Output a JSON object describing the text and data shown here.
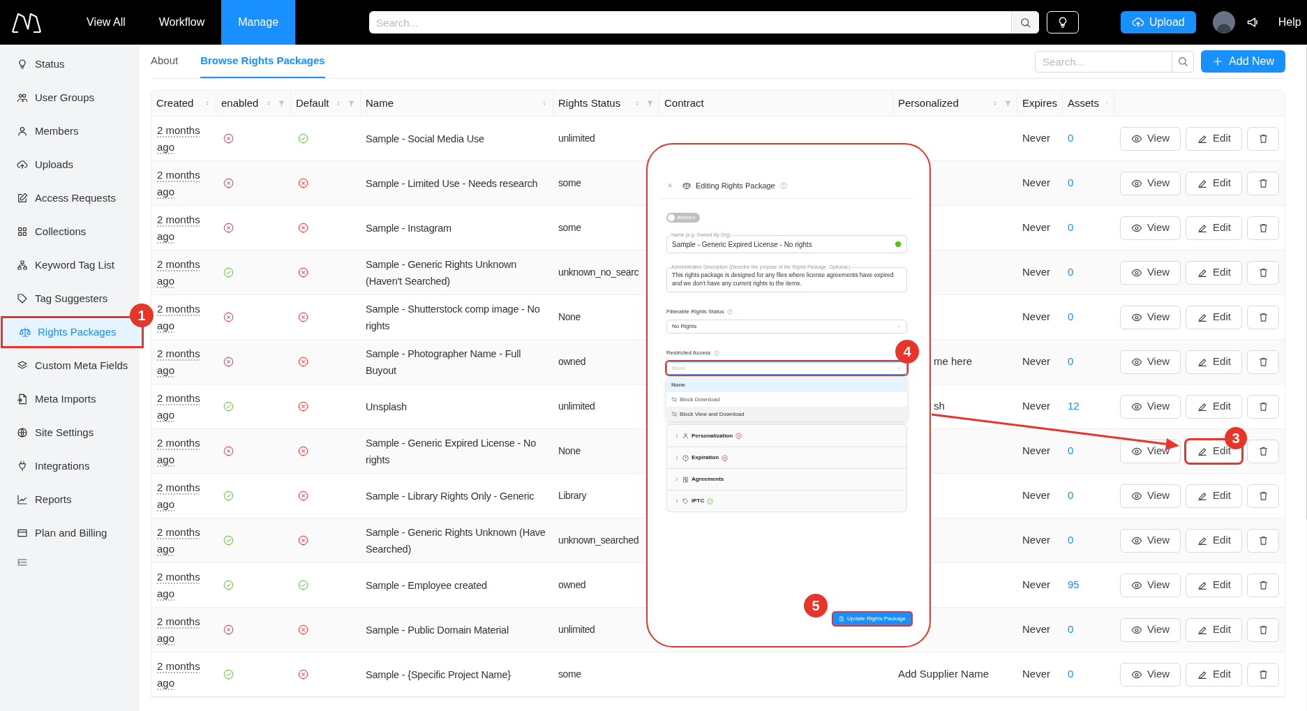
{
  "top_nav": {
    "items": [
      {
        "label": "View All",
        "selected": false
      },
      {
        "label": "Workflow",
        "selected": false
      },
      {
        "label": "Manage",
        "selected": true
      }
    ],
    "search_placeholder": "Search...",
    "upload": "Upload",
    "help": "Help"
  },
  "sidebar": {
    "items": [
      {
        "label": "Status",
        "selected": false
      },
      {
        "label": "User Groups",
        "selected": false
      },
      {
        "label": "Members",
        "selected": false
      },
      {
        "label": "Uploads",
        "selected": false
      },
      {
        "label": "Access Requests",
        "selected": false
      },
      {
        "label": "Collections",
        "selected": false
      },
      {
        "label": "Keyword Tag List",
        "selected": false
      },
      {
        "label": "Tag Suggesters",
        "selected": false
      },
      {
        "label": "Rights Packages",
        "selected": true,
        "callout": "1"
      },
      {
        "label": "Custom Meta Fields",
        "selected": false
      },
      {
        "label": "Meta Imports",
        "selected": false
      },
      {
        "label": "Site Settings",
        "selected": false
      },
      {
        "label": "Integrations",
        "selected": false
      },
      {
        "label": "Reports",
        "selected": false
      },
      {
        "label": "Plan and Billing",
        "selected": false
      }
    ]
  },
  "tabs": [
    {
      "label": "About",
      "selected": false
    },
    {
      "label": "Browse Rights Packages",
      "selected": true
    }
  ],
  "toolbar": {
    "search_placeholder": "Search...",
    "add_button": "Add New"
  },
  "table": {
    "columns": [
      {
        "label": "Created",
        "sortable": true,
        "filterable": false
      },
      {
        "label": "enabled",
        "sortable": true,
        "filterable": true
      },
      {
        "label": "Default",
        "sortable": true,
        "filterable": true
      },
      {
        "label": "Name",
        "sortable": true,
        "filterable": false
      },
      {
        "label": "Rights Status",
        "sortable": true,
        "filterable": true
      },
      {
        "label": "Contract",
        "sortable": false,
        "filterable": false
      },
      {
        "label": "Personalized",
        "sortable": true,
        "filterable": true
      },
      {
        "label": "Expires",
        "sortable": false,
        "filterable": false
      },
      {
        "label": "Assets",
        "sortable": true,
        "filterable": false
      }
    ],
    "rows": [
      {
        "created": "2 months ago",
        "enabled": false,
        "default": true,
        "name": "Sample - Social Media Use",
        "rights_status": "unlimited",
        "expires": "Never",
        "assets": "0",
        "view": "View",
        "edit": "Edit"
      },
      {
        "created": "2 months ago",
        "enabled": false,
        "default": false,
        "name": "Sample - Limited Use - Needs research",
        "rights_status": "some",
        "expires": "Never",
        "assets": "0",
        "view": "View",
        "edit": "Edit"
      },
      {
        "created": "2 months ago",
        "enabled": false,
        "default": false,
        "name": "Sample - Instagram",
        "rights_status": "some",
        "expires": "Never",
        "assets": "0",
        "view": "View",
        "edit": "Edit"
      },
      {
        "created": "2 months ago",
        "enabled": true,
        "default": false,
        "name": "Sample - Generic Rights Unknown (Haven't Searched)",
        "rights_status": "unknown_no_searc",
        "expires": "Never",
        "assets": "0",
        "view": "View",
        "edit": "Edit"
      },
      {
        "created": "2 months ago",
        "enabled": false,
        "default": false,
        "name": "Sample - Shutterstock comp image - No rights",
        "rights_status": "None",
        "expires": "Never",
        "assets": "0",
        "view": "View",
        "edit": "Edit"
      },
      {
        "created": "2 months ago",
        "enabled": false,
        "default": false,
        "name": "Sample - Photographer Name - Full Buyout",
        "rights_status": "owned",
        "personalized": "me here",
        "personalized_cut": true,
        "expires": "Never",
        "assets": "0",
        "view": "View",
        "edit": "Edit"
      },
      {
        "created": "2 months ago",
        "enabled": true,
        "default": false,
        "name": "Unsplash",
        "rights_status": "unlimited",
        "personalized": "sh",
        "personalized_cut": true,
        "expires": "Never",
        "assets": "12",
        "view": "View",
        "edit": "Edit"
      },
      {
        "created": "2 months ago",
        "enabled": false,
        "default": false,
        "name": "Sample - Generic Expired License - No rights",
        "rights_status": "None",
        "expires": "Never",
        "assets": "0",
        "view": "View",
        "edit": "Edit",
        "edit_callout": "3"
      },
      {
        "created": "2 months ago",
        "enabled": true,
        "default": false,
        "name": "Sample - Library Rights Only - Generic",
        "rights_status": "Library",
        "expires": "Never",
        "assets": "0",
        "view": "View",
        "edit": "Edit"
      },
      {
        "created": "2 months ago",
        "enabled": true,
        "default": false,
        "name": "Sample - Generic Rights Unknown (Have Searched)",
        "rights_status": "unknown_searched",
        "expires": "Never",
        "assets": "0",
        "view": "View",
        "edit": "Edit"
      },
      {
        "created": "2 months ago",
        "enabled": true,
        "default": true,
        "name": "Sample - Employee created",
        "rights_status": "owned",
        "expires": "Never",
        "assets": "95",
        "view": "View",
        "edit": "Edit"
      },
      {
        "created": "2 months ago",
        "enabled": false,
        "default": false,
        "name": "Sample - Public Domain Material",
        "rights_status": "unlimited",
        "expires": "Never",
        "assets": "0",
        "view": "View",
        "edit": "Edit"
      },
      {
        "created": "2 months ago",
        "enabled": true,
        "default": false,
        "name": "Sample - {Specific Project Name}",
        "rights_status": "some",
        "personalized": "Add Supplier Name",
        "personalized_cut": false,
        "expires": "Never",
        "assets": "0",
        "view": "View",
        "edit": "Edit"
      }
    ]
  },
  "dialog": {
    "title": "Editing Rights Package",
    "toggle": {
      "label": "disabled",
      "on": false
    },
    "name_field": {
      "label": "Name (e.g. Owned By Org)",
      "value": "Sample - Generic Expired License - No rights",
      "valid": true
    },
    "description_field": {
      "label": "Administrative Description (Describe the purpose of the Rights Package. Optional.)",
      "value": "This rights package is designed for any files where license agreements have expired and we don’t have any current rights to the items."
    },
    "rights_status": {
      "label": "Filterable Rights Status",
      "value": "No Rights"
    },
    "restricted_access": {
      "label": "Restricted Access",
      "placeholder": "None",
      "callout": "4",
      "options": [
        {
          "label": "None",
          "selected": true,
          "hovered": false
        },
        {
          "label": "Block Download",
          "selected": false,
          "hovered": false
        },
        {
          "label": "Block View and Download",
          "selected": false,
          "hovered": true
        }
      ]
    },
    "sections": [
      {
        "label": "Personalization",
        "valid": false
      },
      {
        "label": "Expiration",
        "valid": false
      },
      {
        "label": "Agreements"
      },
      {
        "label": "IPTC",
        "valid": true
      }
    ],
    "submit": {
      "label": "Update Rights Package",
      "callout": "5"
    }
  }
}
